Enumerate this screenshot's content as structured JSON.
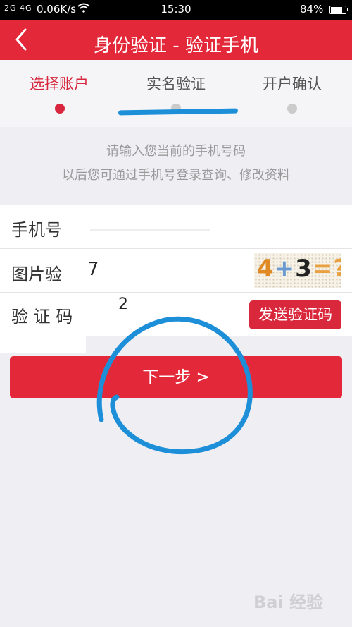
{
  "status_bar": {
    "signal": "2G 4G",
    "speed": "0.06K/s",
    "time": "15:30",
    "battery_pct": "84%",
    "battery_level": 0.84
  },
  "nav": {
    "title": "身份验证 - 验证手机",
    "back_icon": "chevron-left-icon"
  },
  "steps": {
    "items": [
      {
        "label": "选择账户",
        "active": true
      },
      {
        "label": "实名验证",
        "active": false
      },
      {
        "label": "开户确认",
        "active": false
      }
    ]
  },
  "hint": {
    "line1": "请输入您当前的手机号码",
    "line2": "以后您可通过手机号登录查询、修改资料"
  },
  "form": {
    "phone_label": "手机号",
    "captcha_label": "图片验",
    "captcha_value": "7",
    "captcha_image": {
      "a": "4",
      "op": "+",
      "b": "3",
      "eq": "=?"
    },
    "code_label": "验 证 码",
    "code_value": "2",
    "send_code_label": "发送验证码"
  },
  "next_label": "下一步 >",
  "watermark": "Bai 经验",
  "colors": {
    "brand_red": "#e3283a",
    "annotation_blue": "#1d8fd8"
  }
}
